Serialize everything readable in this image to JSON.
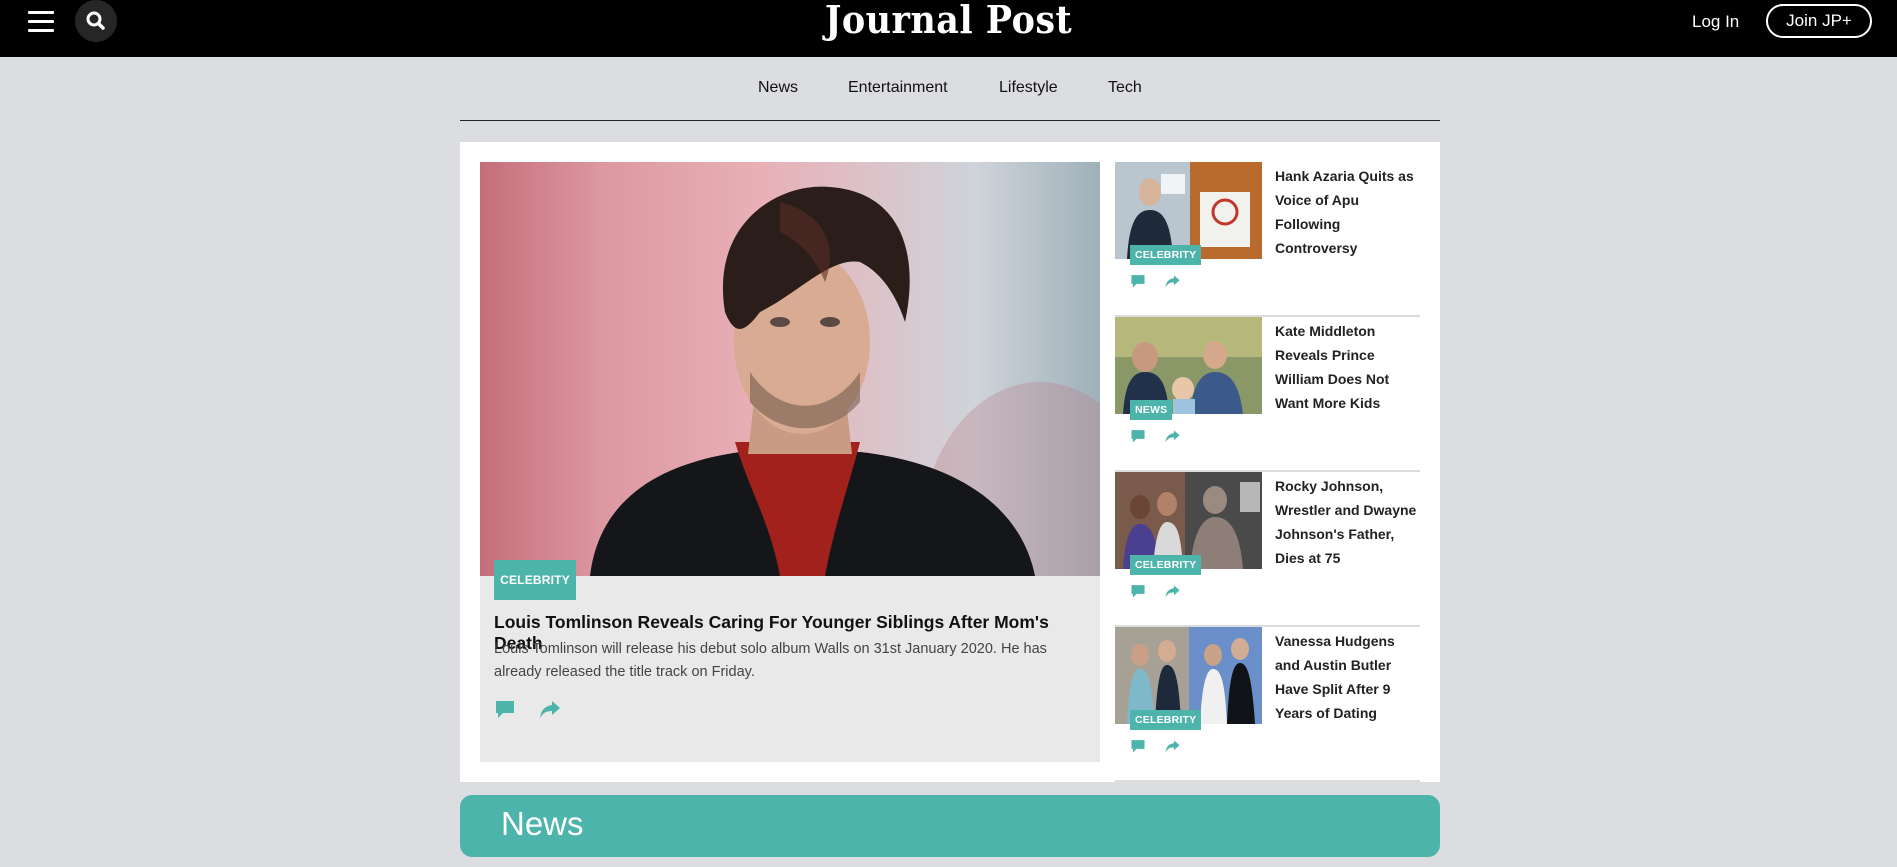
{
  "header": {
    "logo": "Journal Post",
    "login": "Log In",
    "join": "Join JP+"
  },
  "nav": [
    "News",
    "Entertainment",
    "Lifestyle",
    "Tech"
  ],
  "hero": {
    "category": "CELEBRITY",
    "title": "Louis Tomlinson Reveals Caring For Younger Siblings After Mom's Death",
    "description": "Louis Tomlinson will release his debut solo album Walls on 31st January 2020. He has already released the title track on Friday."
  },
  "side_articles": [
    {
      "category": "CELEBRITY",
      "title": "Hank Azaria Quits as Voice of Apu Following Controversy"
    },
    {
      "category": "NEWS",
      "title": "Kate Middleton Reveals Prince William Does Not Want More Kids"
    },
    {
      "category": "CELEBRITY",
      "title": "Rocky Johnson, Wrestler and Dwayne Johnson's Father, Dies at 75"
    },
    {
      "category": "CELEBRITY",
      "title": "Vanessa Hudgens and Austin Butler Have Split After 9 Years of Dating"
    }
  ],
  "section": {
    "title": "News"
  },
  "colors": {
    "accent": "#4db4ab",
    "header_bg": "#000000",
    "page_bg": "#dcdde0"
  },
  "icons": {
    "menu": "hamburger-icon",
    "search": "search-icon",
    "comment": "comment-icon",
    "share": "share-icon"
  }
}
